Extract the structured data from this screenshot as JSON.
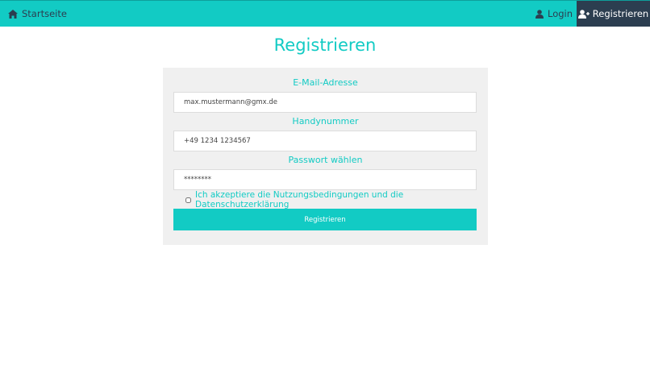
{
  "navbar": {
    "home": {
      "label": "Startseite",
      "icon": "home-icon"
    },
    "login": {
      "label": "Login",
      "icon": "user-icon"
    },
    "register": {
      "label": "Registrieren",
      "icon": "user-plus-icon"
    },
    "colors": {
      "bar": "#12cbc4",
      "active": "#2c3e50"
    }
  },
  "page": {
    "title": "Registrieren"
  },
  "form": {
    "email": {
      "label": "E-Mail-Adresse",
      "value": "max.mustermann@gmx.de"
    },
    "phone": {
      "label": "Handynummer",
      "value": "+49 1234 1234567"
    },
    "password": {
      "label": "Passwort wählen",
      "value": "********"
    },
    "terms": {
      "label": "Ich akzeptiere die Nutzungsbedingungen und die Datenschutzerklärung",
      "checked": false
    },
    "submit_label": "Registrieren"
  }
}
